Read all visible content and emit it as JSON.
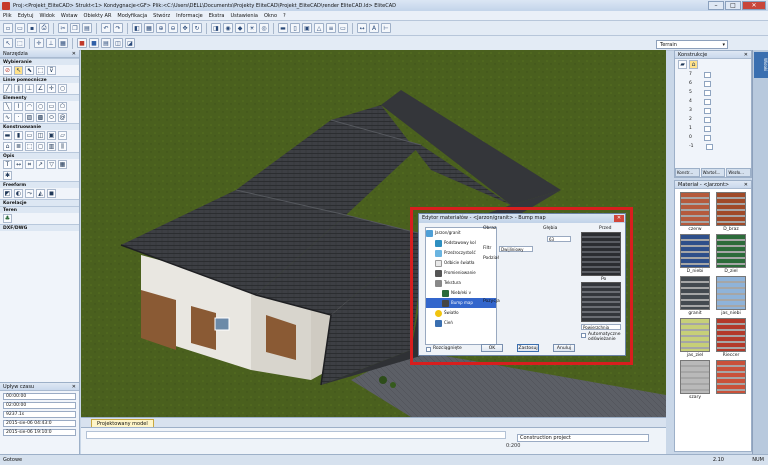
{
  "window": {
    "title": "Proj:<Projekt_EliteCAD> Strukt<1> Kondygnacje<GF> Plik:<C:\\Users\\DELL\\Documents\\Projekty EliteCAD\\Projekt_EliteCAD\\render EliteCAD.ld> EliteCAD"
  },
  "menu": [
    "Plik",
    "Edytuj",
    "Widok",
    "Wstaw",
    "Obiekty AR",
    "Modyfikacja",
    "Stwórz",
    "Informacje",
    "Ekstra",
    "Ustawienia",
    "Okno",
    "?"
  ],
  "toolbar": {
    "terrain_combo": "Terrain"
  },
  "left_panel": {
    "title": "Narzędzia",
    "sections": [
      "Wybieranie",
      "Linie pomocnicze",
      "Elementy",
      "Konstruowanie",
      "Opis",
      "Freeform",
      "Korelacje",
      "Teren",
      "DXF/DWG"
    ]
  },
  "time_panel": {
    "title": "Upływ czasu",
    "start_time": "00:00:00",
    "interval": "02:00:00",
    "count": "9237.1s",
    "date1": "2015-sie-06 04:43:0",
    "date2": "2015-sie-06 19:10:0"
  },
  "doc_tab": "Projektowany model",
  "command": {
    "project_name": "Construction project",
    "coordinate": "0:200"
  },
  "status": {
    "left": "Gotowe",
    "version": "2.10",
    "right": "NUM"
  },
  "right_strip": {
    "tab1": "Widoki"
  },
  "konstrukcja": {
    "title": "Konstrukcje",
    "levels": [
      "7",
      "6",
      "5",
      "4",
      "3",
      "2",
      "1",
      "0",
      "-1"
    ],
    "tabs": [
      "Konstr...",
      "Wartoś...",
      "Wezło..."
    ]
  },
  "materials": {
    "title": "Materiał - <Jarzont>",
    "items": [
      {
        "name": "czerw",
        "color": "#b55a3c"
      },
      {
        "name": "D_braz",
        "color": "#a04a28"
      },
      {
        "name": "D_niebi",
        "color": "#2e4f8a"
      },
      {
        "name": "D_ziel",
        "color": "#2c6b3a"
      },
      {
        "name": "granit",
        "color": "#444a50"
      },
      {
        "name": "jas_niebi",
        "color": "#8fb3d9"
      },
      {
        "name": "jas_ziel",
        "color": "#c7cf78"
      },
      {
        "name": "Rieccer",
        "color": "#b33a2a"
      },
      {
        "name": "szary",
        "color": "#b9b9b9"
      },
      {
        "name": "",
        "color": "#c9513a"
      }
    ]
  },
  "dialog": {
    "title": "Edytor materiałów - <Jarzon/granit> - Bump map",
    "tree": [
      "Jarzon/granit",
      "Podstawowy kol",
      "Przeźroczystość",
      "Odbicie światła",
      "Promieniowanie",
      "Tekstura",
      "Nieb/eki v",
      "Bump map",
      "Światło",
      "Cień"
    ],
    "image_label": "Obraz",
    "depth_label": "Głębia",
    "depth_value": "63",
    "filter_label": "Filtr",
    "filter_value": "Dwijliniowy",
    "mapping_label": "Podział",
    "position_label": "Pozycja",
    "before_label": "Przed",
    "after_label": "Po",
    "surface_select": "Powierzchnia",
    "auto_refresh": "Automatyczne odświeżanie",
    "rectangle_label": "Rozciągnięte",
    "ok": "OK",
    "save": "Zastosuj",
    "cancel": "Anuluj"
  },
  "colors": {
    "highlight": "#d81e1e",
    "ground": "#465c1c",
    "roof": "#3c3e42"
  }
}
